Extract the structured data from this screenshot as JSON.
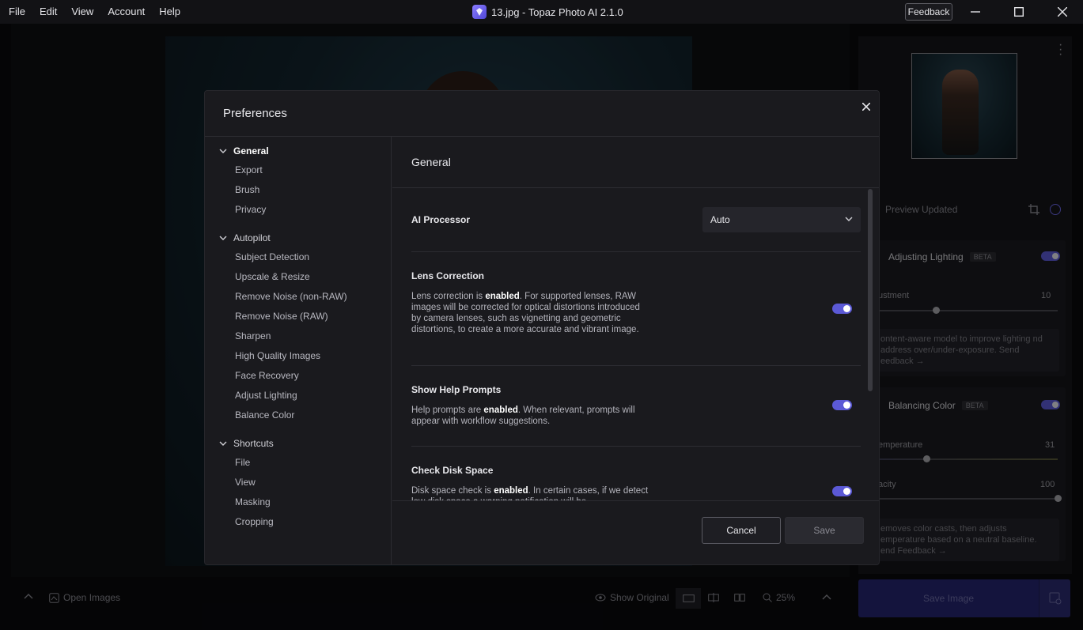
{
  "menu": [
    "File",
    "Edit",
    "View",
    "Account",
    "Help"
  ],
  "window_title": "13.jpg - Topaz Photo AI 2.1.0",
  "feedback_label": "Feedback",
  "right_panel": {
    "preview_status": "Preview Updated",
    "lighting": {
      "title": "Adjusting Lighting",
      "beta": "BETA",
      "slider_label": "ustment",
      "slider_value": "10",
      "slider_fraction": 0.3,
      "desc": "ontent-aware model to improve lighting nd address over/under-exposure. Send eedback →"
    },
    "color": {
      "title": "Balancing Color",
      "beta": "BETA",
      "temp_label": "emperature",
      "temp_value": "31",
      "temp_fraction": 0.2,
      "opacity_label": "acity",
      "opacity_value": "100",
      "opacity_fraction": 1.0,
      "desc": "emoves color casts, then adjusts emperature based on a neutral baseline. end Feedback →"
    }
  },
  "bottom": {
    "open_images": "Open Images",
    "show_original": "Show Original",
    "zoom": "25%",
    "save_image": "Save Image"
  },
  "modal": {
    "title": "Preferences",
    "nav": [
      {
        "group": "General",
        "active": true,
        "items": [
          "Export",
          "Brush",
          "Privacy"
        ]
      },
      {
        "group": "Autopilot",
        "active": false,
        "items": [
          "Subject Detection",
          "Upscale & Resize",
          "Remove Noise (non-RAW)",
          "Remove Noise (RAW)",
          "Sharpen",
          "High Quality Images",
          "Face Recovery",
          "Adjust Lighting",
          "Balance Color"
        ]
      },
      {
        "group": "Shortcuts",
        "active": false,
        "items": [
          "File",
          "View",
          "Masking",
          "Cropping"
        ]
      }
    ],
    "content_title": "General",
    "ai_processor": {
      "label": "AI Processor",
      "value": "Auto"
    },
    "lens": {
      "label": "Lens Correction",
      "desc_pre": "Lens correction is ",
      "desc_bold": "enabled",
      "desc_post": ". For supported lenses, RAW images will be corrected for optical distortions introduced by camera lenses, such as vignetting and geometric distortions, to create a more accurate and vibrant image.",
      "on": true
    },
    "help": {
      "label": "Show Help Prompts",
      "desc_pre": "Help prompts are ",
      "desc_bold": "enabled",
      "desc_post": ". When relevant, prompts will appear with workflow suggestions.",
      "on": true
    },
    "disk": {
      "label": "Check Disk Space",
      "desc_pre": "Disk space check is ",
      "desc_bold": "enabled",
      "desc_post": ". In certain cases, if we detect low disk space a warning notification will be",
      "on": true
    },
    "cancel": "Cancel",
    "save": "Save"
  },
  "colors": {
    "accent": "#5b59d6"
  }
}
